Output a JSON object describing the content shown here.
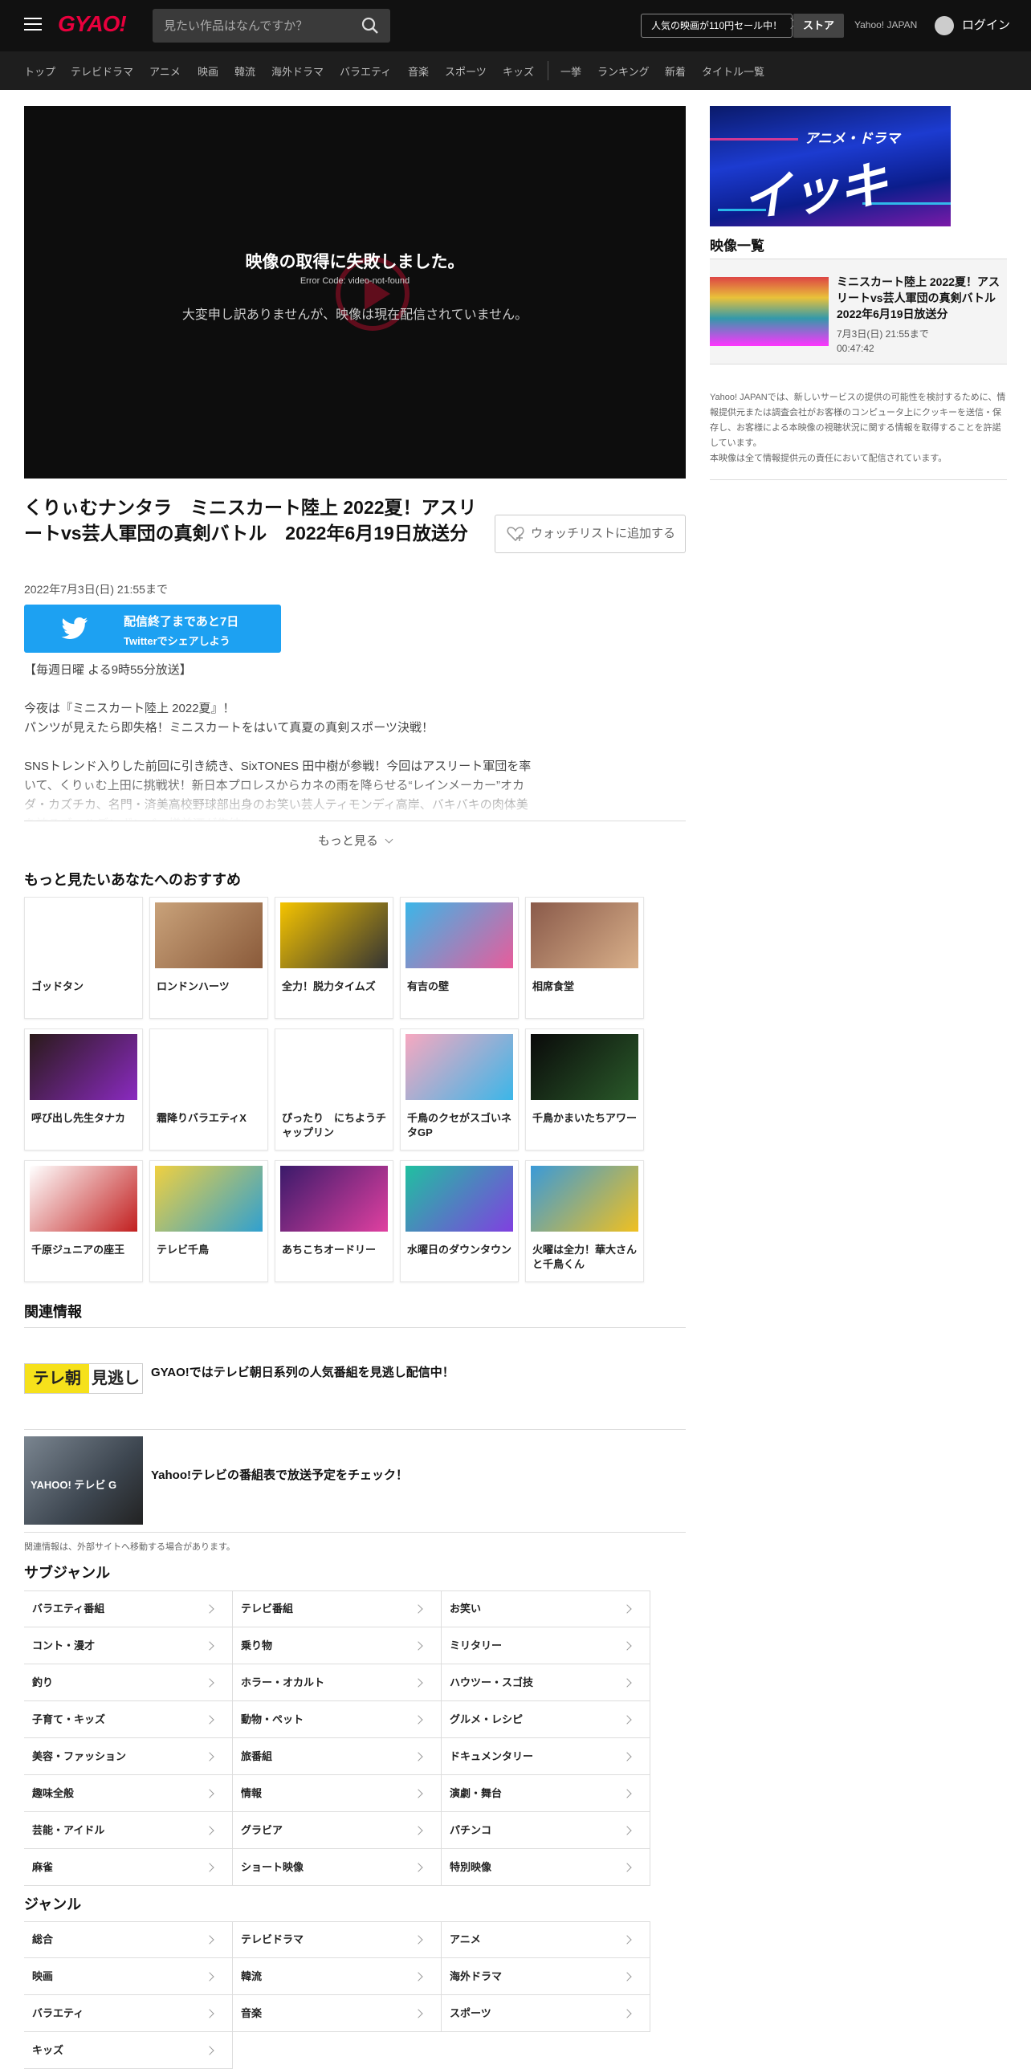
{
  "header": {
    "logo": "GYAO!",
    "search_placeholder": "見たい作品はなんですか？",
    "promo": "人気の映画が110円セール中！",
    "store": "ストア",
    "yahoo": "Yahoo! JAPAN",
    "login": "ログイン"
  },
  "nav": [
    "トップ",
    "テレビドラマ",
    "アニメ",
    "映画",
    "韓流",
    "海外ドラマ",
    "バラエティ",
    "音楽",
    "スポーツ",
    "キッズ",
    "一挙",
    "ランキング",
    "新着",
    "タイトル一覧"
  ],
  "player": {
    "error_title": "映像の取得に失敗しました。",
    "error_code": "Error Code: video-not-found",
    "error_message": "大変申し訳ありませんが、映像は現在配信されていません。"
  },
  "video": {
    "title": "くりぃむナンタラ　ミニスカート陸上 2022夏！アスリートvs芸人軍団の真剣バトル　2022年6月19日放送分",
    "watchlist": "ウォッチリストに追加する",
    "date": "2022年7月3日(日) 21:55まで",
    "twitter_line1": "配信終了まであと7日",
    "twitter_line2": "Twitterでシェアしよう",
    "schedule": "【毎週日曜 よる9時55分放送】",
    "desc1": "今夜は『ミニスカート陸上 2022夏』！\nパンツが見えたら即失格！ミニスカートをはいて真夏の真剣スポーツ決戦！",
    "desc2": "SNSトレンド入りした前回に引き続き、SixTONES 田中樹が参戦！今回はアスリート軍団を率いて、くりぃむ上田に挑戦状！新日本プロレスからカネの雨を降らせる“レインメーカー”オカダ・カズチカ、名門・済美高校野球部出身のお笑い芸人ティモンディ高岸、バキバキの肉体美を誇るゴールデンボンバー樽美酒が集結!!",
    "more": "もっと見る"
  },
  "recommend": {
    "heading": "もっと見たいあなたへのおすすめ",
    "items": [
      "ゴッドタン",
      "ロンドンハーツ",
      "全力！脱力タイムズ",
      "有吉の壁",
      "相席食堂",
      "呼び出し先生タナカ",
      "霜降りバラエティX",
      "ぴったり　にちようチャップリン",
      "千鳥のクセがスゴいネタGP",
      "千鳥かまいたちアワー",
      "千原ジュニアの座王",
      "テレビ千鳥",
      "あちこちオードリー",
      "水曜日のダウンタウン",
      "火曜は全力！華大さんと千鳥くん"
    ]
  },
  "related": {
    "heading": "関連情報",
    "logo_a": "テレ朝",
    "logo_b": "見逃し",
    "item1": "GYAO!ではテレビ朝日系列の人気番組を見逃し配信中！",
    "img2": "YAHOO! テレビ G",
    "item2": "Yahoo!テレビの番組表で放送予定をチェック！",
    "note": "関連情報は、外部サイトへ移動する場合があります。"
  },
  "subgenre": {
    "heading": "サブジャンル",
    "items": [
      "バラエティ番組",
      "テレビ番組",
      "お笑い",
      "コント・漫才",
      "乗り物",
      "ミリタリー",
      "釣り",
      "ホラー・オカルト",
      "ハウツー・スゴ技",
      "子育て・キッズ",
      "動物・ペット",
      "グルメ・レシピ",
      "美容・ファッション",
      "旅番組",
      "ドキュメンタリー",
      "趣味全般",
      "情報",
      "演劇・舞台",
      "芸能・アイドル",
      "グラビア",
      "パチンコ",
      "麻雀",
      "ショート映像",
      "特別映像"
    ]
  },
  "genre": {
    "heading": "ジャンル",
    "items": [
      "総合",
      "テレビドラマ",
      "アニメ",
      "映画",
      "韓流",
      "海外ドラマ",
      "バラエティ",
      "音楽",
      "スポーツ",
      "キッズ"
    ]
  },
  "side": {
    "banner_top": "アニメ・ドラマ",
    "banner_main": "イッキ見!",
    "heading": "映像一覧",
    "item_title": "ミニスカート陸上 2022夏！アスリートvs芸人軍団の真剣バトル　2022年6月19日放送分",
    "item_date": "7月3日(日) 21:55まで",
    "item_duration": "00:47:42",
    "note": "Yahoo! JAPANでは、新しいサービスの提供の可能性を検討するために、情報提供元または調査会社がお客様のコンピュータ上にクッキーを送信・保存し、お客様による本映像の視聴状況に関する情報を取得することを許諾しています。\n本映像は全て情報提供元の責任において配信されています。"
  },
  "colors": {
    "brand": "#e8003d",
    "twitter": "#1da1f2",
    "header_bg": "#111111"
  }
}
